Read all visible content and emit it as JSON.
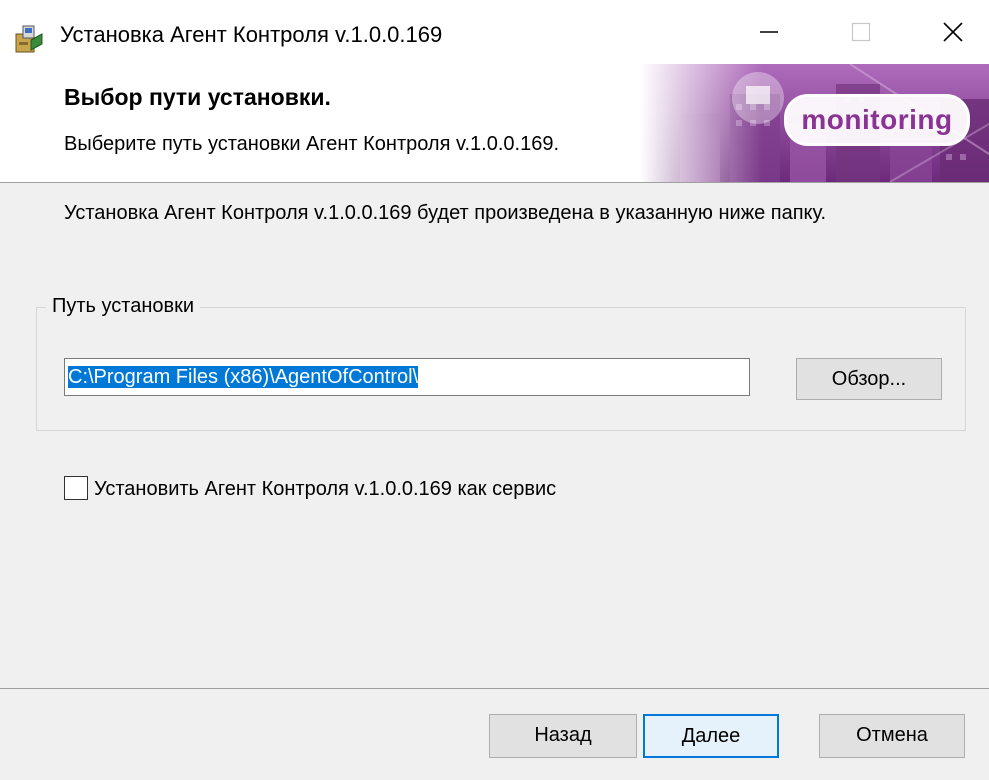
{
  "window": {
    "title": "Установка Агент Контроля v.1.0.0.169",
    "icon": "installer-package-icon",
    "controls": {
      "minimize": "minimize-icon",
      "maximize": "maximize-icon",
      "close": "close-icon"
    }
  },
  "header": {
    "title": "Выбор пути установки.",
    "subtitle": "Выберите путь установки Агент Контроля v.1.0.0.169.",
    "brand": "monitoring"
  },
  "body": {
    "info": "Установка Агент Контроля v.1.0.0.169 будет произведена в указанную ниже папку.",
    "group_label": "Путь установки",
    "path_value": "C:\\Program Files (x86)\\AgentOfControl\\",
    "browse_label": "Обзор...",
    "service_checkbox_label": "Установить Агент Контроля v.1.0.0.169 как сервис",
    "service_checked": false
  },
  "footer": {
    "back_label": "Назад",
    "next_label": "Далее",
    "cancel_label": "Отмена"
  },
  "colors": {
    "selection": "#0078d7",
    "brand_text": "#8a3394",
    "banner": "#9b4fa9",
    "dialog_bg": "#f0f0f0"
  }
}
